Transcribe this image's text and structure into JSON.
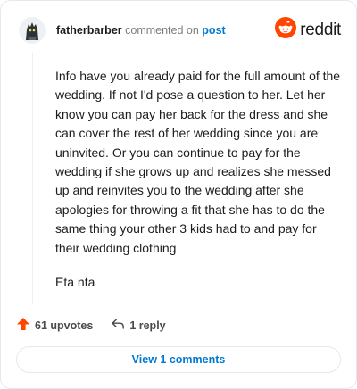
{
  "header": {
    "username": "fatherbarber",
    "action_text": "commented on",
    "post_link": "post",
    "brand": "reddit"
  },
  "comment": {
    "paragraphs": [
      "Info have you already paid for the full amount of the wedding. If not I'd pose a question to her. Let her know you can pay her back for the dress and she can cover the rest of her wedding since you are uninvited. Or you can continue to pay for the wedding if she grows up and realizes she messed up and reinvites you to the wedding after she apologies for throwing a fit that she has to do the same thing your other 3 kids had to and pay for their wedding clothing",
      "Eta nta"
    ]
  },
  "actions": {
    "upvotes": "61 upvotes",
    "replies": "1 reply"
  },
  "footer": {
    "view_comments": "View 1 comments"
  },
  "colors": {
    "accent": "#0079d3",
    "upvote": "#ff4500",
    "brand": "#ff4500"
  },
  "icons": [
    "avatar",
    "reddit-logo-icon",
    "upvote-arrow-icon",
    "reply-icon"
  ]
}
